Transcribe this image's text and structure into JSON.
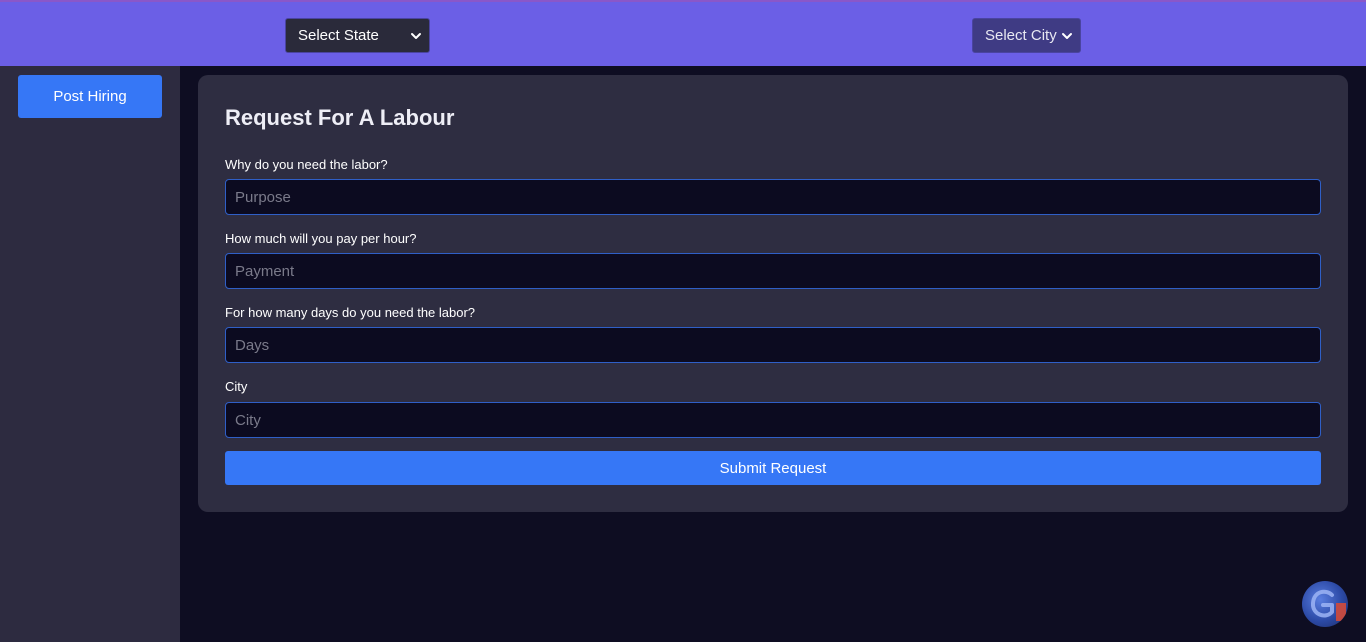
{
  "topbar": {
    "state_select": {
      "selected": "Select State"
    },
    "city_select": {
      "selected": "Select City"
    }
  },
  "sidebar": {
    "post_hiring_label": "Post Hiring"
  },
  "form": {
    "title": "Request For A Labour",
    "fields": [
      {
        "label": "Why do you need the labor?",
        "placeholder": "Purpose"
      },
      {
        "label": "How much will you pay per hour?",
        "placeholder": "Payment"
      },
      {
        "label": "For how many days do you need the labor?",
        "placeholder": "Days"
      },
      {
        "label": "City",
        "placeholder": "City"
      }
    ],
    "submit_label": "Submit Request"
  },
  "colors": {
    "topbar": "#6b5fe6",
    "accent": "#3677f6",
    "page_bg": "#0e0d22",
    "sidebar_bg": "#2d2b40",
    "card_bg": "#2e2d41",
    "input_bg": "#0c0b20",
    "input_border": "#2f5fc7"
  },
  "icons": {
    "select_arrow": "chevron-down-icon",
    "badge": "translate-badge-icon"
  }
}
